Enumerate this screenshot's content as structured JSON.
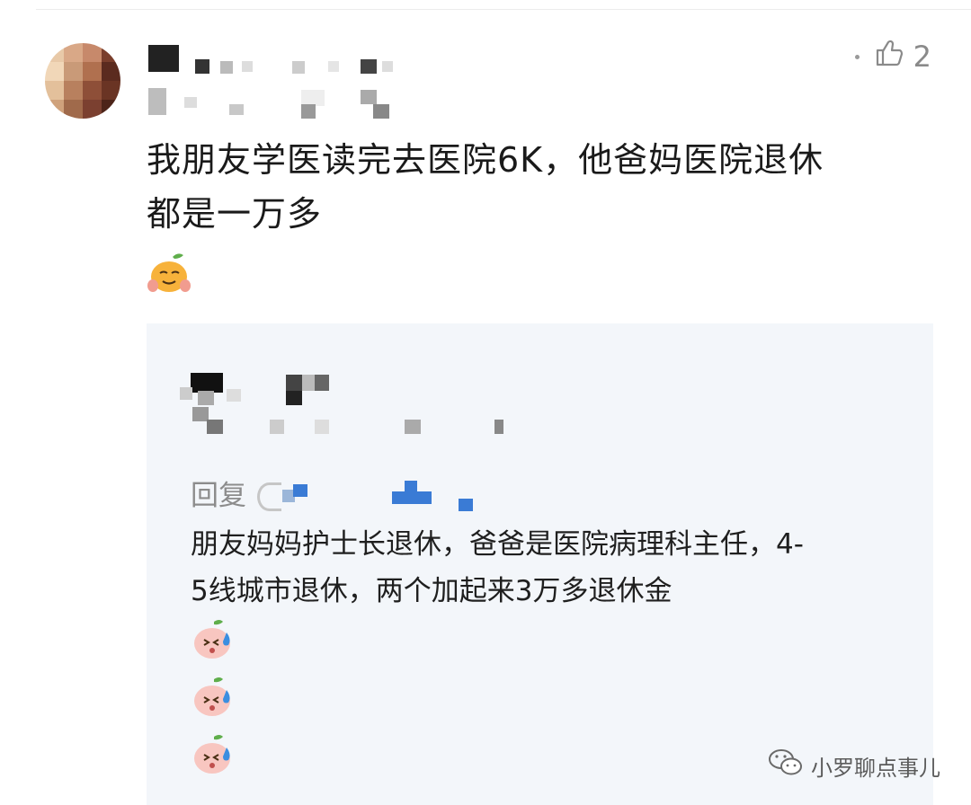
{
  "comment": {
    "like_count": "2",
    "text_line1": "我朋友学医读完去医院6K，他爸妈医院退休",
    "text_line2": "都是一万多"
  },
  "reply": {
    "prefix": "回复",
    "text_line1": "朋友妈妈护士长退休，爸爸是医院病理科主任，4-",
    "text_line2": "5线城市退休，两个加起来3万多退休金"
  },
  "watermark": {
    "text": "小罗聊点事儿"
  },
  "icons": {
    "like": "thumbs-up-icon",
    "emoji_main": "embarrassed-face-emoji",
    "emoji_reply": "sweat-face-emoji",
    "watermark": "wechat-icon"
  },
  "colors": {
    "text": "#1a1a1a",
    "muted": "#8c8c8c",
    "reply_bg": "#f3f6fa",
    "mention_blue": "#3a7bd5"
  }
}
